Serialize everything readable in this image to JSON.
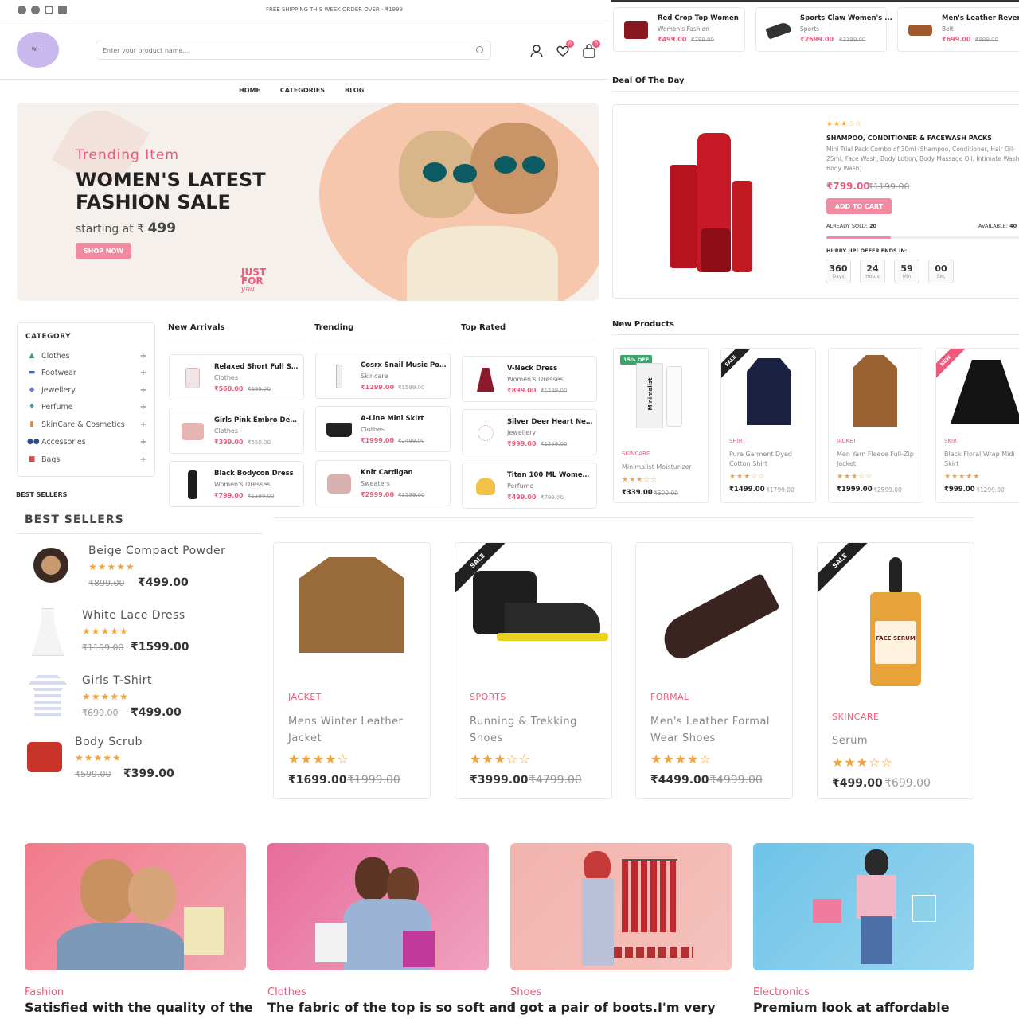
{
  "topbar": {
    "shipping_notice": "FREE SHIPPING THIS WEEK ORDER OVER - ₹1999",
    "social": [
      "facebook-icon",
      "twitter-icon",
      "instagram-icon",
      "linkedin-icon"
    ]
  },
  "header": {
    "search_placeholder": "Enter your product name...",
    "wishlist_count": "0",
    "cart_count": "0"
  },
  "nav": [
    "HOME",
    "CATEGORIES",
    "BLOG"
  ],
  "hero": {
    "subtitle": "Trending Item",
    "title_line1": "WOMEN'S LATEST",
    "title_line2": "FASHION SALE",
    "starting_label": "starting at ₹",
    "starting_price": "499",
    "cta": "SHOP NOW",
    "stamp_line1": "JUST",
    "stamp_line2": "FOR",
    "stamp_line3": "you"
  },
  "top_products": [
    {
      "title": "Red Crop Top Women",
      "category": "Women's Fashion",
      "price": "₹499.00",
      "old": "₹799.00"
    },
    {
      "title": "Sports Claw Women's ...",
      "category": "Sports",
      "price": "₹2699.00",
      "old": "₹3199.00"
    },
    {
      "title": "Men's Leather Reversi...",
      "category": "Belt",
      "price": "₹699.00",
      "old": "₹999.00"
    }
  ],
  "deal": {
    "section_title": "Deal Of The Day",
    "rating": "★★★☆☆",
    "title": "SHAMPOO, CONDITIONER & FACEWASH PACKS",
    "description": "Mini Trial Pack Combo of 30ml (Shampoo, Conditioner, Hair Oil- 25ml, Face Wash, Body Lotion, Body Massage Oil, Intimate Wash, Body Wash)",
    "price": "₹799.00",
    "old_price": "₹1199.00",
    "cta": "ADD TO CART",
    "sold_label": "ALREADY SOLD:",
    "sold": "20",
    "available_label": "AVAILABLE:",
    "available": "40",
    "sold_fraction": 0.33,
    "hurry": "HURRY UP! OFFER ENDS IN:",
    "timer": [
      {
        "value": "360",
        "label": "Days"
      },
      {
        "value": "24",
        "label": "Hours"
      },
      {
        "value": "59",
        "label": "Min"
      },
      {
        "value": "00",
        "label": "Sec"
      }
    ]
  },
  "categories": {
    "title": "CATEGORY",
    "items": [
      {
        "label": "Clothes",
        "icon": "dress-icon"
      },
      {
        "label": "Footwear",
        "icon": "shoe-icon"
      },
      {
        "label": "Jewellery",
        "icon": "jewel-icon"
      },
      {
        "label": "Perfume",
        "icon": "perfume-icon"
      },
      {
        "label": "SkinCare & Cosmetics",
        "icon": "cosmetics-icon"
      },
      {
        "label": "Accessories",
        "icon": "glasses-icon"
      },
      {
        "label": "Bags",
        "icon": "bag-icon"
      }
    ]
  },
  "lists": {
    "new_arrivals": {
      "title": "New Arrivals",
      "items": [
        {
          "title": "Relaxed Short Full Slee...",
          "category": "Clothes",
          "price": "₹560.00",
          "old": "₹699.00"
        },
        {
          "title": "Girls Pink Embro Desig...",
          "category": "Clothes",
          "price": "₹399.00",
          "old": "₹550.00"
        },
        {
          "title": "Black Bodycon Dress",
          "category": "Women's Dresses",
          "price": "₹799.00",
          "old": "₹1299.00"
        }
      ]
    },
    "trending": {
      "title": "Trending",
      "items": [
        {
          "title": "Cosrx Snail Music Pow...",
          "category": "Skincare",
          "price": "₹1299.00",
          "old": "₹1599.00"
        },
        {
          "title": "A-Line Mini Skirt",
          "category": "Clothes",
          "price": "₹1999.00",
          "old": "₹2499.00"
        },
        {
          "title": "Knit Cardigan",
          "category": "Sweaters",
          "price": "₹2999.00",
          "old": "₹3599.00"
        }
      ]
    },
    "top_rated": {
      "title": "Top Rated",
      "items": [
        {
          "title": "V-Neck Dress",
          "category": "Women's Dresses",
          "price": "₹899.00",
          "old": "₹1299.00"
        },
        {
          "title": "Silver Deer Heart Neck...",
          "category": "Jewellery",
          "price": "₹999.00",
          "old": "₹1299.00"
        },
        {
          "title": "Titan 100 ML Womens ...",
          "category": "Perfume",
          "price": "₹499.00",
          "old": "₹799.00"
        }
      ]
    }
  },
  "new_products": {
    "title": "New Products",
    "items": [
      {
        "badge": "15% OFF",
        "category": "SKINCARE",
        "name": "Minimalist Moisturizer",
        "stars": "★★★☆☆",
        "price": "₹339.00",
        "old": "₹399.00",
        "image_label": "Minimalist"
      },
      {
        "badge": "SALE",
        "category": "SHIRT",
        "name": "Pure Garment Dyed Cotton Shirt",
        "stars": "★★★☆☆",
        "price": "₹1499.00",
        "old": "₹1799.00"
      },
      {
        "badge": "",
        "category": "JACKET",
        "name": "Men Yarn Fleece Full-Zip Jacket",
        "stars": "★★★☆☆",
        "price": "₹1999.00",
        "old": "₹2599.00"
      },
      {
        "badge": "NEW",
        "category": "SKIRT",
        "name": "Black Floral Wrap Midi Skirt",
        "stars": "★★★★★",
        "price": "₹999.00",
        "old": "₹1299.00"
      }
    ]
  },
  "best_sellers": {
    "small_title": "BEST SELLERS",
    "title": "BEST SELLERS",
    "items": [
      {
        "name": "Beige Compact Powder",
        "stars": "★★★★★",
        "old": "₹899.00",
        "price": "₹499.00"
      },
      {
        "name": "White Lace Dress",
        "stars": "★★★★★",
        "old": "₹1199.00",
        "price": "₹1599.00"
      },
      {
        "name": "Girls T-Shirt",
        "stars": "★★★★★",
        "old": "₹699.00",
        "price": "₹499.00"
      },
      {
        "name": "Body Scrub",
        "stars": "★★★★★",
        "old": "₹599.00",
        "price": "₹399.00"
      }
    ]
  },
  "featured": [
    {
      "badge": "",
      "category": "JACKET",
      "name_line1": "Mens Winter Leather",
      "name_line2": "Jacket",
      "stars": "★★★★☆",
      "price": "₹1699.00",
      "old": "₹1999.00"
    },
    {
      "badge": "SALE",
      "category": "SPORTS",
      "name_line1": "Running & Trekking",
      "name_line2": "Shoes",
      "stars": "★★★☆☆",
      "price": "₹3999.00",
      "old": "₹4799.00"
    },
    {
      "badge": "",
      "category": "FORMAL",
      "name_line1": "Men's Leather Formal",
      "name_line2": "Wear Shoes",
      "stars": "★★★★☆",
      "price": "₹4499.00",
      "old": "₹4999.00"
    },
    {
      "badge": "SALE",
      "category": "SKINCARE",
      "name_line1": "Serum",
      "name_line2": "",
      "stars": "★★★☆☆",
      "price": "₹499.00",
      "old": "₹699.00",
      "bottle_label": "FACE SERUM"
    }
  ],
  "testimonials": [
    {
      "category": "Fashion",
      "text": "Satisfied with the quality of the"
    },
    {
      "category": "Clothes",
      "text": "The fabric of the top is so soft and"
    },
    {
      "category": "Shoes",
      "text": "I got a pair of boots.I'm very"
    },
    {
      "category": "Electronics",
      "text": "Premium look at affordable"
    }
  ],
  "colors": {
    "accent": "#ef5a7c",
    "star": "#f2a33a"
  }
}
